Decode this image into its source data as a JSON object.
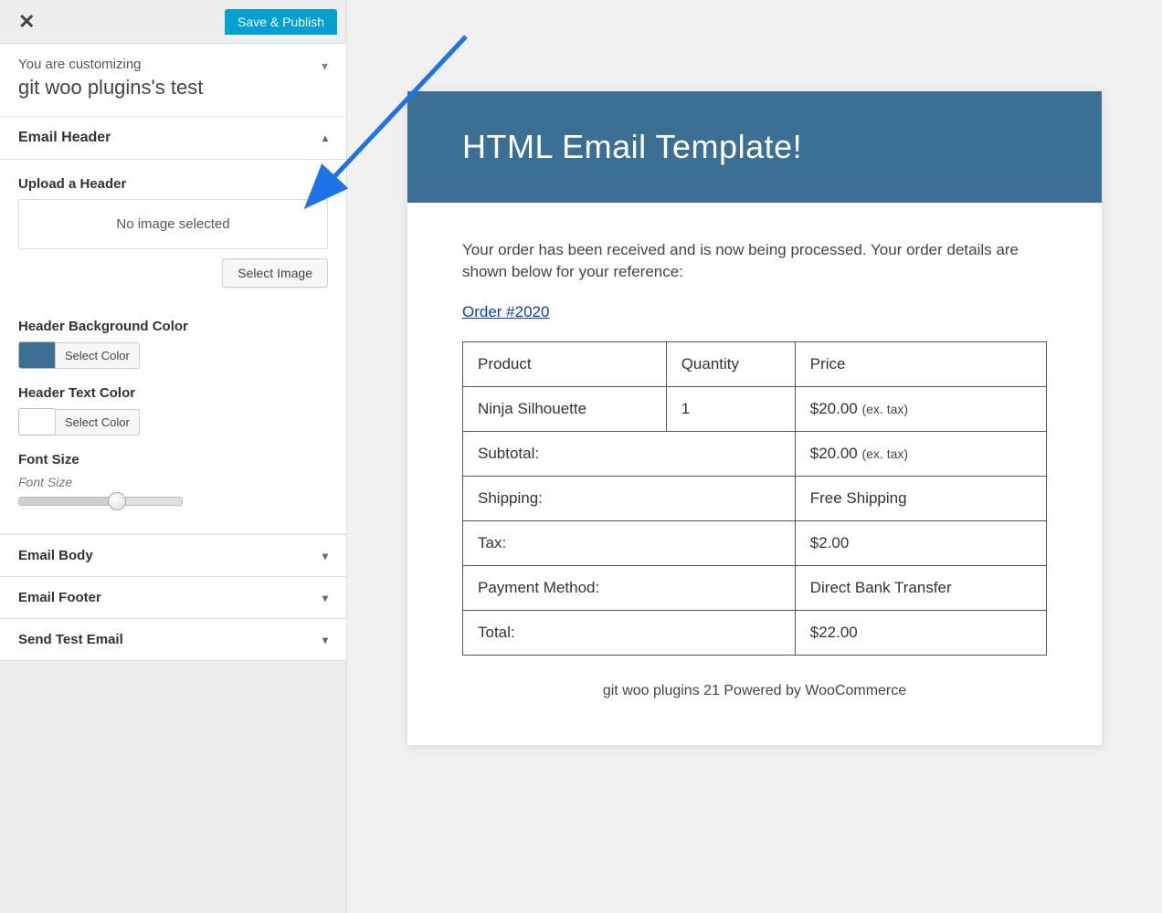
{
  "topbar": {
    "save_publish_label": "Save & Publish"
  },
  "context": {
    "label": "You are customizing",
    "title": "git woo plugins's test"
  },
  "accordion": {
    "header_open": {
      "title": "Email Header"
    },
    "sections": {
      "upload_header_label": "Upload a Header",
      "no_image_text": "No image selected",
      "select_image_label": "Select Image",
      "bg_color_label": "Header Background Color",
      "bg_color_value": "#3b6f93",
      "select_color_label": "Select Color",
      "text_color_label": "Header Text Color",
      "text_color_value": "#ffffff",
      "font_size_label": "Font Size",
      "font_size_sublabel": "Font Size",
      "font_size_value": 60
    },
    "collapsed": [
      {
        "title": "Email Body"
      },
      {
        "title": "Email Footer"
      },
      {
        "title": "Send Test Email"
      }
    ]
  },
  "email": {
    "header_title": "HTML Email Template!",
    "header_bg": "#3b6f93",
    "intro": "Your order has been received and is now being processed. Your order details are shown below for your reference:",
    "order_link_text": "Order #2020",
    "table": {
      "headers": {
        "product": "Product",
        "quantity": "Quantity",
        "price": "Price"
      },
      "item": {
        "product": "Ninja Silhouette",
        "quantity": "1",
        "price_amount": "$20.00",
        "price_note": "(ex. tax)"
      },
      "rows": [
        {
          "label": "Subtotal:",
          "amount": "$20.00",
          "note": "(ex. tax)"
        },
        {
          "label": "Shipping:",
          "amount": "Free Shipping",
          "note": ""
        },
        {
          "label": "Tax:",
          "amount": "$2.00",
          "note": ""
        },
        {
          "label": "Payment Method:",
          "amount": "Direct Bank Transfer",
          "note": ""
        },
        {
          "label": "Total:",
          "amount": "$22.00",
          "note": ""
        }
      ]
    },
    "footer_text": "git woo plugins 21 Powered by WooCommerce"
  }
}
